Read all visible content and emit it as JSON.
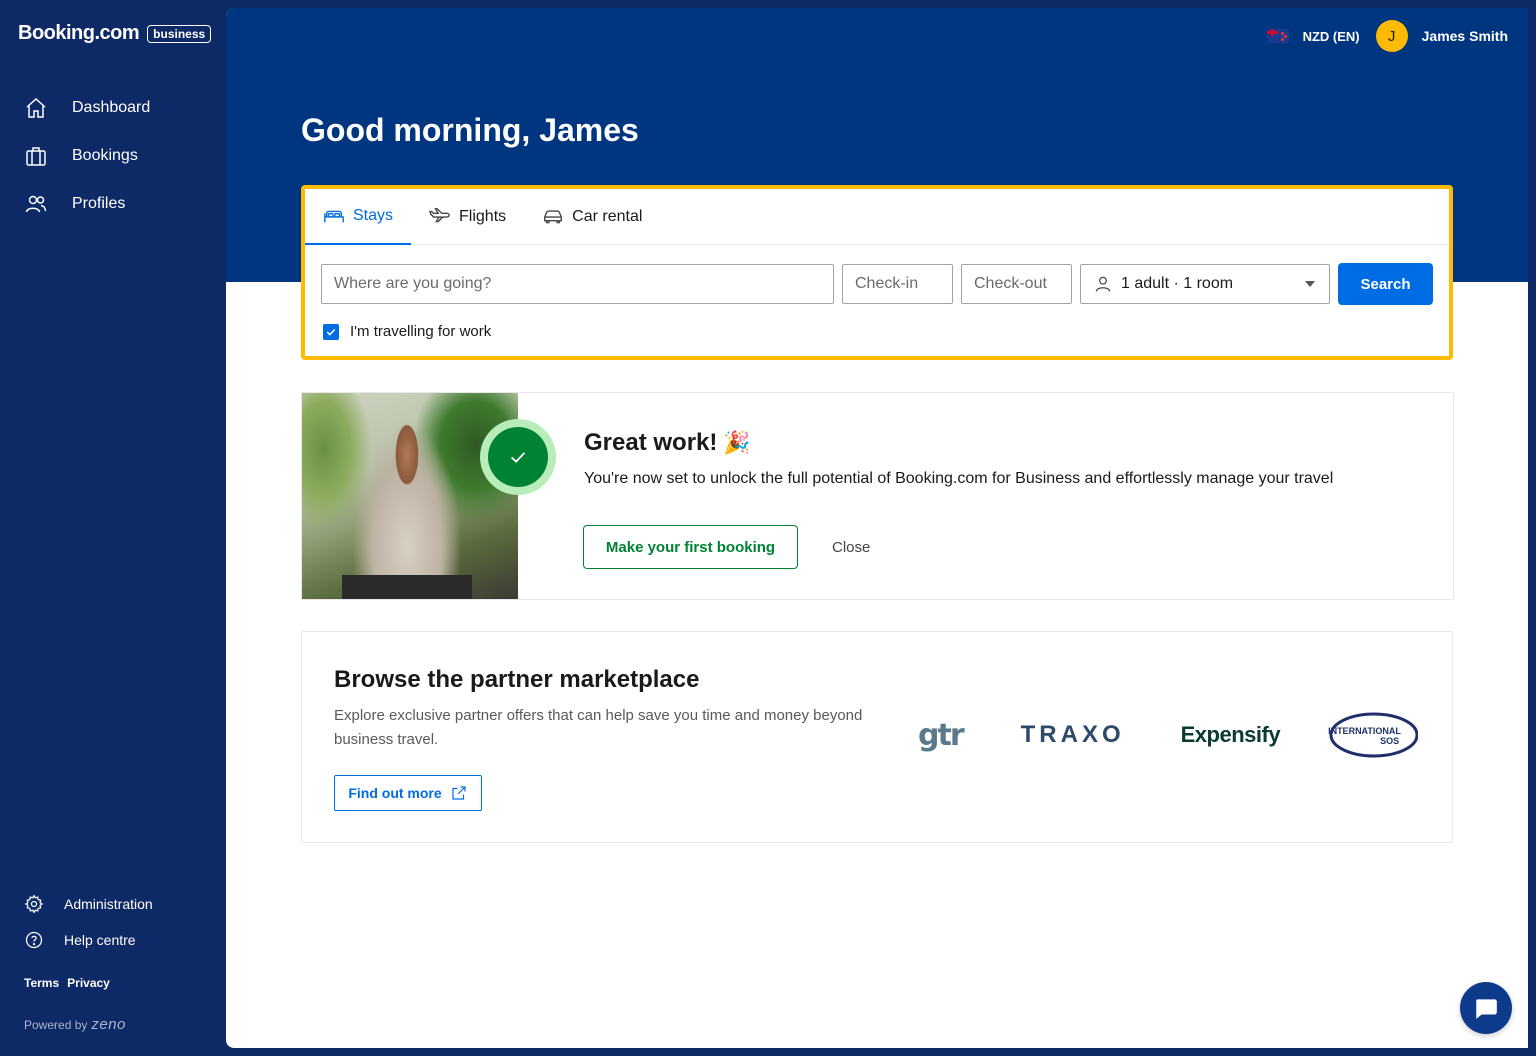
{
  "brand": {
    "name": "Booking.com",
    "badge": "business"
  },
  "sidebar": {
    "items": [
      {
        "label": "Dashboard",
        "icon": "home-icon"
      },
      {
        "label": "Bookings",
        "icon": "briefcase-icon"
      },
      {
        "label": "Profiles",
        "icon": "people-icon"
      }
    ],
    "bottom": [
      {
        "label": "Administration",
        "icon": "gear-icon"
      },
      {
        "label": "Help centre",
        "icon": "help-circle-icon"
      }
    ],
    "legal": {
      "terms": "Terms",
      "privacy": "Privacy"
    },
    "powered": {
      "prefix": "Powered by",
      "brand": "zeno"
    }
  },
  "topbar": {
    "currency": "NZD (EN)",
    "avatar_initial": "J",
    "user_name": "James Smith"
  },
  "hero": {
    "greeting": "Good morning, James"
  },
  "search": {
    "tabs": [
      {
        "label": "Stays",
        "icon": "bed-icon",
        "active": true
      },
      {
        "label": "Flights",
        "icon": "plane-icon",
        "active": false
      },
      {
        "label": "Car rental",
        "icon": "car-icon",
        "active": false
      }
    ],
    "destination_placeholder": "Where are you going?",
    "checkin_placeholder": "Check-in",
    "checkout_placeholder": "Check-out",
    "guests": "1 adult · 1 room",
    "button": "Search",
    "work_label": "I'm travelling for work",
    "work_checked": true
  },
  "success": {
    "title": "Great work!",
    "emoji": "🎉",
    "subtitle": "You're now set to unlock the full potential of Booking.com for Business and effortlessly manage your travel",
    "primary_button": "Make your first booking",
    "close_button": "Close"
  },
  "marketplace": {
    "title": "Browse the partner marketplace",
    "description": "Explore exclusive partner offers that can help save you time and money beyond business travel.",
    "button": "Find out more",
    "logos": [
      "gtr",
      "TRAXO",
      "Expensify",
      "INTERNATIONAL",
      "SOS"
    ]
  },
  "colors": {
    "sidebar": "#0d2a66",
    "hero": "#003580",
    "accent": "#006ce4",
    "highlight": "#febb02",
    "success": "#008234"
  }
}
